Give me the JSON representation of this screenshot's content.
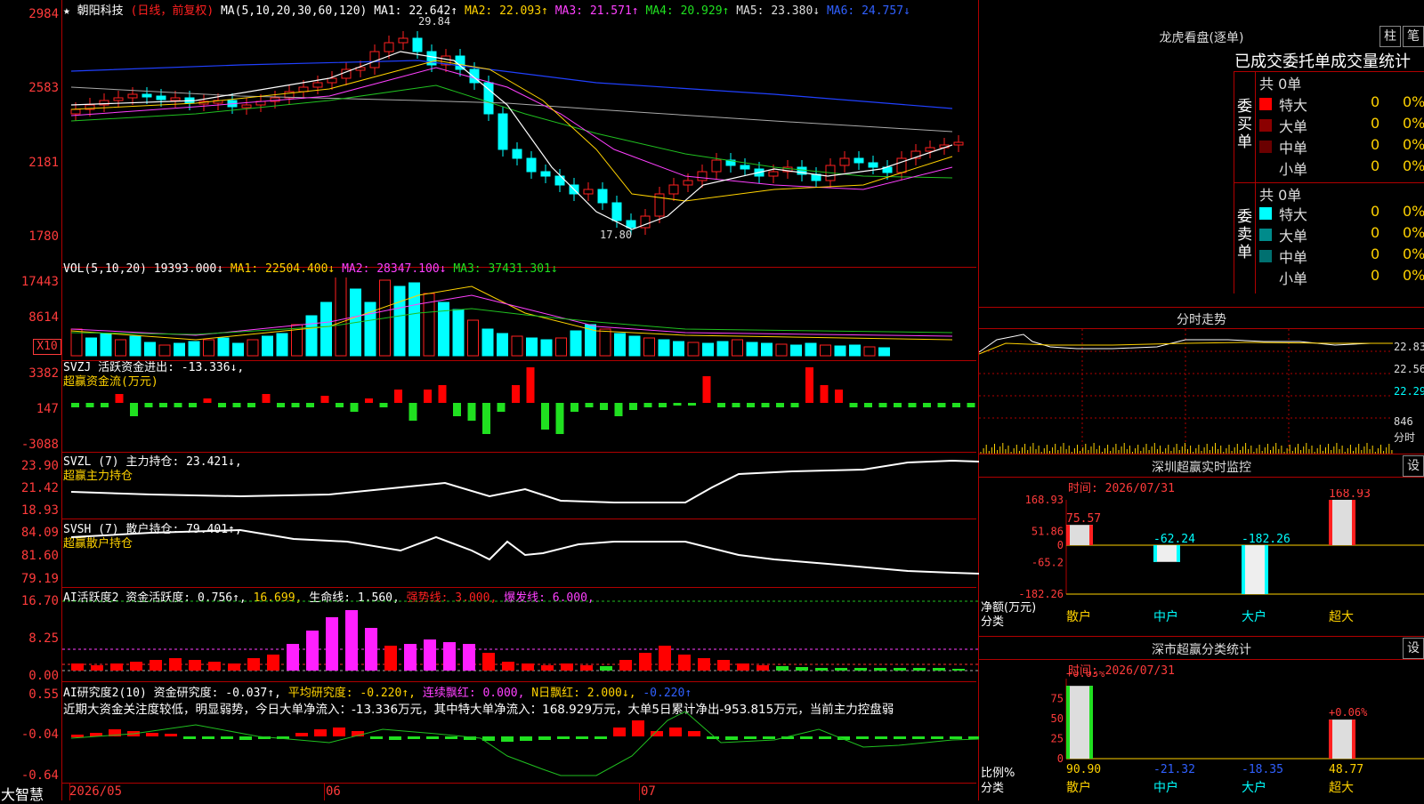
{
  "chart_header": {
    "star": "★",
    "stock_name": "朝阳科技",
    "mode": "(日线，前复权)",
    "ma_label": "MA(5,10,20,30,60,120)",
    "ma1": "MA1: 22.642↑",
    "ma2": "MA2: 22.093↑",
    "ma3": "MA3: 21.571↑",
    "ma4": "MA4: 20.929↑",
    "ma5": "MA5: 23.380↓",
    "ma6": "MA6: 24.757↓"
  },
  "price_axis": [
    "2984",
    "2583",
    "2181",
    "1780"
  ],
  "price_annotations": {
    "high": "29.84",
    "low": "17.80"
  },
  "vol": {
    "title": "VOL(5,10,20)",
    "value": "19393.000↓",
    "ma1": "MA1: 22504.400↓",
    "ma2": "MA2: 28347.100↓",
    "ma3": "MA3: 37431.301↓",
    "axis": [
      "17443",
      "8614"
    ],
    "unit": "X10"
  },
  "svzj": {
    "title": "SVZJ  活跃资金进出: -13.336↓,",
    "subtitle": "超赢资金流(万元)",
    "axis": [
      "3382",
      "147",
      "-3088"
    ]
  },
  "svzl": {
    "title": "SVZL (7) 主力持仓: 23.421↓,",
    "subtitle": "超赢主力持仓",
    "axis": [
      "23.90",
      "21.42",
      "18.93"
    ]
  },
  "svsh": {
    "title": "SVSH (7) 散户持仓: 79.401↑,",
    "subtitle": "超赢散户持仓",
    "axis": [
      "84.09",
      "81.60",
      "79.19"
    ]
  },
  "ai_active": {
    "title_a": "AI活跃度2 资金活跃度: 0.756↑, ",
    "title_b": "16.699, ",
    "title_c": "生命线: 1.560, ",
    "title_d": "强势线: 3.000, ",
    "title_e": "爆发线: 6.000,",
    "axis": [
      "16.70",
      "8.25",
      "0.00"
    ]
  },
  "ai_research": {
    "title_a": "AI研究度2(10) 资金研究度: -0.037↑, ",
    "title_b": "平均研究度: -0.220↑, ",
    "title_c": "连续飘红: 0.000, ",
    "title_d": "N日飘红: 2.000↓, ",
    "title_e": "-0.220↑",
    "commentary": "近期大资金关注度较低，明显弱势，今日大单净流入：-13.336万元，其中特大单净流入：168.929万元，大单5日累计净出-953.815万元，当前主力控盘弱",
    "axis": [
      "0.55",
      "-0.04",
      "-0.64"
    ]
  },
  "footer": {
    "brand": "大智慧",
    "dates": [
      "2026/05",
      "06",
      "07"
    ]
  },
  "lhb": {
    "title": "龙虎看盘(逐单)",
    "btn_a": "柱",
    "btn_b": "笔",
    "table_title": "已成交委托单成交量统计",
    "buy_label": "委买单",
    "sell_label": "委卖单",
    "buy_total": "共 0单",
    "sell_total": "共 0单",
    "buy_rows": [
      {
        "name": "特大",
        "count": "0",
        "pct": "0%",
        "color": "#ff0000"
      },
      {
        "name": "大单",
        "count": "0",
        "pct": "0%",
        "color": "#8b0000"
      },
      {
        "name": "中单",
        "count": "0",
        "pct": "0%",
        "color": "#6a0000"
      },
      {
        "name": "小单",
        "count": "0",
        "pct": "0%",
        "color": "#000000"
      }
    ],
    "sell_rows": [
      {
        "name": "特大",
        "count": "0",
        "pct": "0%",
        "color": "#00ffff"
      },
      {
        "name": "大单",
        "count": "0",
        "pct": "0%",
        "color": "#008b8b"
      },
      {
        "name": "中单",
        "count": "0",
        "pct": "0%",
        "color": "#007070"
      },
      {
        "name": "小单",
        "count": "0",
        "pct": "0%",
        "color": "#000000"
      }
    ]
  },
  "intraday": {
    "title": "分时走势",
    "axis": [
      "22.83",
      "22.56",
      "22.29"
    ],
    "vol_value": "846",
    "vol_label": "分时"
  },
  "monitor": {
    "title": "深圳超赢实时监控",
    "settings": "设",
    "time": "时间: 2026/07/31",
    "axis": [
      "168.93",
      "51.86",
      "0",
      "-65.2",
      "-182.26"
    ],
    "unit_a": "净额(万元)",
    "unit_b": "分类",
    "categories": [
      "散户",
      "中户",
      "大户",
      "超大"
    ],
    "values": [
      75.57,
      -62.24,
      -182.26,
      168.93
    ],
    "value_labels": [
      "75.57",
      "-62.24",
      "-182.26",
      "168.93"
    ]
  },
  "classify": {
    "title": "深市超赢分类统计",
    "settings": "设",
    "time": "时间: 2026/07/31",
    "axis": [
      "75",
      "50",
      "25",
      "0"
    ],
    "unit_a": "比例%",
    "unit_b": "分类",
    "pct_top": [
      "+0.03%",
      "+0.06%"
    ],
    "categories": [
      "散户",
      "中户",
      "大户",
      "超大"
    ],
    "values": [
      90.9,
      -21.32,
      -18.35,
      48.77
    ],
    "value_labels": [
      "90.90",
      "-21.32",
      "-18.35",
      "48.77"
    ]
  }
}
